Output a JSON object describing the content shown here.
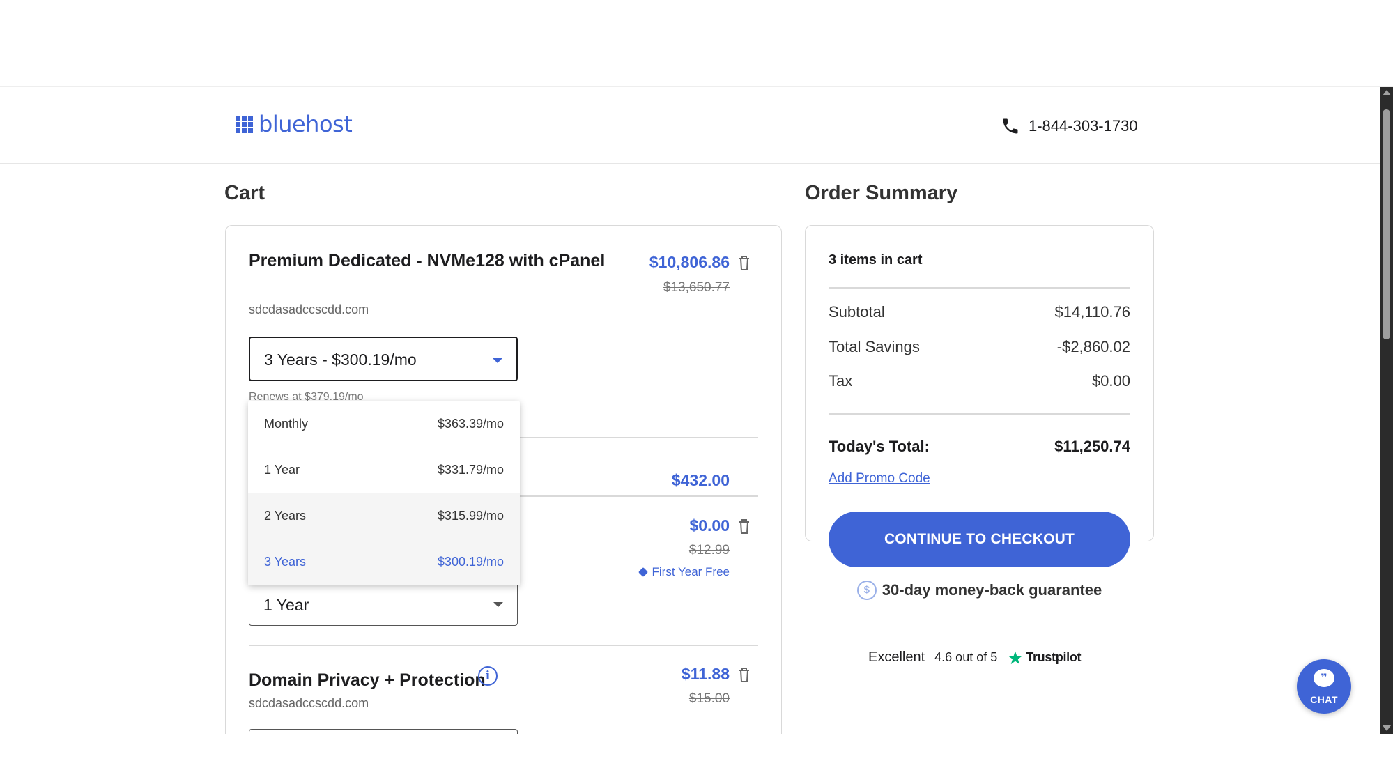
{
  "header": {
    "logo_text": "bluehost",
    "phone": "1-844-303-1730"
  },
  "cart": {
    "heading": "Cart",
    "item1": {
      "title": "Premium Dedicated - NVMe128 with cPanel",
      "domain": "sdcdasadccscdd.com",
      "price": "$10,806.86",
      "old_price": "$13,650.77",
      "term_selected": "3 Years - $300.19/mo",
      "renews": "Renews at $379.19/mo"
    },
    "item2": {
      "price": "$432.00"
    },
    "item3": {
      "price": "$0.00",
      "old_price": "$12.99",
      "promo_tag": "First Year Free",
      "term_selected": "1 Year"
    },
    "item4": {
      "title": "Domain Privacy + Protection",
      "domain": "sdcdasadccscdd.com",
      "price": "$11.88",
      "old_price": "$15.00"
    },
    "term_dropdown": {
      "options": [
        {
          "label": "Monthly",
          "price": "$363.39/mo"
        },
        {
          "label": "1 Year",
          "price": "$331.79/mo"
        },
        {
          "label": "2 Years",
          "price": "$315.99/mo"
        },
        {
          "label": "3 Years",
          "price": "$300.19/mo"
        }
      ],
      "selected": "3 Years",
      "hovered": "2 Years"
    }
  },
  "summary": {
    "heading": "Order Summary",
    "items_count": "3 items in cart",
    "subtotal_label": "Subtotal",
    "subtotal": "$14,110.76",
    "savings_label": "Total Savings",
    "savings": "-$2,860.02",
    "tax_label": "Tax",
    "tax": "$0.00",
    "total_label": "Today's Total:",
    "total": "$11,250.74",
    "promo_link": "Add Promo Code",
    "checkout_label": "CONTINUE TO CHECKOUT",
    "guarantee": "30-day money-back guarantee",
    "guarantee_icon": "dollar-coin-icon"
  },
  "trustpilot": {
    "rating_word": "Excellent",
    "score": "4.6 out of 5",
    "brand": "Trustpilot"
  },
  "chat": {
    "label": "CHAT"
  },
  "colors": {
    "accent": "#3f64d6",
    "text": "#1d1d1f",
    "muted": "#777777",
    "trustpilot_green": "#00b67a"
  }
}
